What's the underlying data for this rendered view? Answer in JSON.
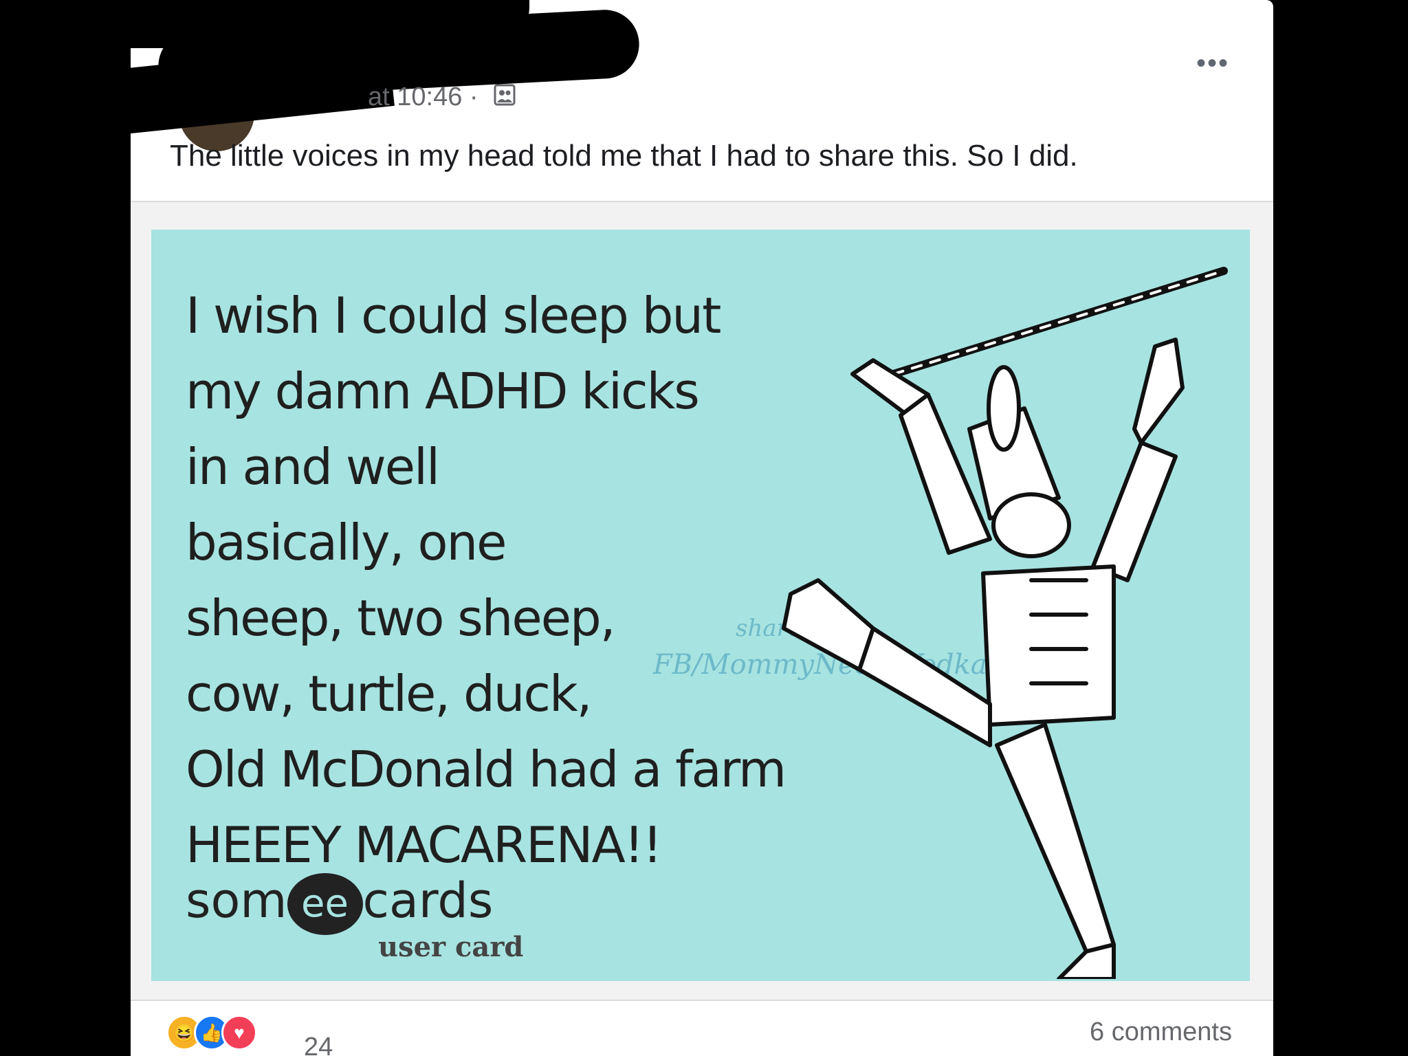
{
  "post": {
    "timestamp_partial": "at 10:46 ·",
    "caption": "The little voices in my head told me that I had to share this. So I did.",
    "more_label": "•••",
    "privacy_icon": "friends-icon"
  },
  "ecard": {
    "lines": [
      "I wish I could sleep but",
      "my damn ADHD kicks",
      "in and well",
      "basically, one",
      "sheep, two sheep,",
      "cow, turtle, duck,",
      "Old McDonald had a farm",
      "HEEEY MACARENA!!"
    ],
    "watermark_shared": "shared by",
    "watermark_source": "FB/MommyNeedsVodka",
    "logo_prefix": "som",
    "logo_ee": "ee",
    "logo_suffix": "cards",
    "logo_sub": "user card",
    "background_color": "#a7e3e1"
  },
  "footer": {
    "reaction_icons": [
      "haha-icon",
      "like-icon",
      "love-icon"
    ],
    "reaction_count": "24",
    "comments_label": "6 comments"
  }
}
